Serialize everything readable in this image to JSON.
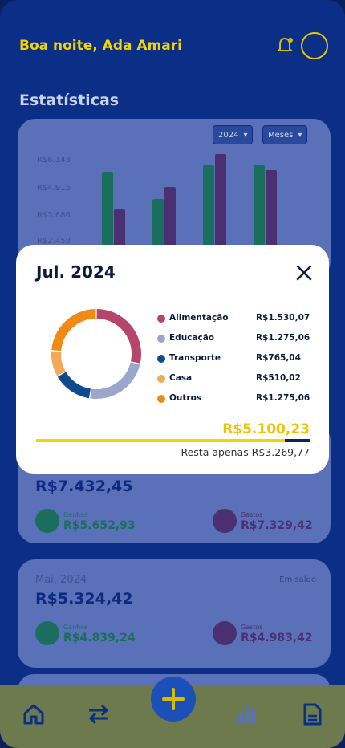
{
  "header": {
    "greeting": "Boa noite, Ada Amari"
  },
  "stats": {
    "title": "Estatísticas",
    "year_select": "2024",
    "period_select": "Meses",
    "y_ticks": [
      "R$6.143",
      "R$4.915",
      "R$3.686",
      "R$2.458"
    ]
  },
  "colors": {
    "accent_yellow": "#f5d200",
    "navy": "#0c2356",
    "alimentacao": "#b6456a",
    "educacao": "#9ba6cc",
    "transporte": "#0f4b8c",
    "casa": "#f4a95a",
    "outros": "#f08a14"
  },
  "month_cards": [
    {
      "label": "",
      "tag": "",
      "value": "R$7.432,45",
      "income_label": "Ganhos",
      "income": "R$5.652,93",
      "expense_label": "Gastos",
      "expense": "R$7.329,42"
    },
    {
      "label": "Mai. 2024",
      "tag": "Em saldo",
      "value": "R$5.324,42",
      "income_label": "Ganhos",
      "income": "R$4.839,24",
      "expense_label": "Gastos",
      "expense": "R$4.983,42"
    }
  ],
  "modal": {
    "title": "Jul. 2024",
    "total": "R$5.100,23",
    "remaining": "Resta apenas R$3.269,77",
    "progress_fraction": 0.91,
    "categories": [
      {
        "name": "Alimentação",
        "value": "R$1.530,07",
        "amount": 1530.07,
        "color": "#b6456a"
      },
      {
        "name": "Educação",
        "value": "R$1.275,06",
        "amount": 1275.06,
        "color": "#9ba6cc"
      },
      {
        "name": "Transporte",
        "value": "R$765,04",
        "amount": 765.04,
        "color": "#0f4b8c"
      },
      {
        "name": "Casa",
        "value": "R$510,02",
        "amount": 510.02,
        "color": "#f4a95a"
      },
      {
        "name": "Outros",
        "value": "R$1.275,06",
        "amount": 1275.06,
        "color": "#f08a14"
      }
    ]
  },
  "icons": {
    "bell": "bell-icon",
    "profile": "profile-icon",
    "close": "close-icon",
    "home": "home-icon",
    "transfer": "transfer-icon",
    "add": "add-icon",
    "stats": "bar-chart-icon",
    "report": "report-icon"
  }
}
